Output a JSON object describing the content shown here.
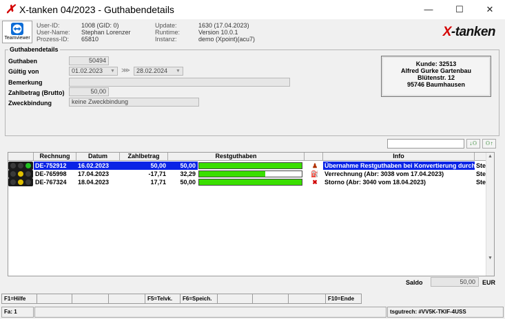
{
  "window": {
    "title": "X-tanken 04/2023 - Guthabendetails",
    "minimize": "—",
    "maximize": "☐",
    "close": "✕"
  },
  "header": {
    "teamviewer_label": "Teamviewer",
    "user_id_label": "User-ID:",
    "user_id": "1008 (GID: 0)",
    "user_name_label": "User-Name:",
    "user_name": "Stephan Lorenzer",
    "prozess_id_label": "Prozess-ID:",
    "prozess_id": "65810",
    "update_label": "Update:",
    "update": "1630 (17.04.2023)",
    "runtime_label": "Runtime:",
    "runtime": "Version 10.0.1",
    "instanz_label": "Instanz:",
    "instanz": "demo (Xpoint)(acu7)",
    "brand_x": "X",
    "brand_rest": "-tanken"
  },
  "details": {
    "group_title": "Guthabendetails",
    "guthaben_label": "Guthaben",
    "guthaben_value": "50494",
    "gueltig_label": "Gültig von",
    "gueltig_von": "01.02.2023",
    "gueltig_bis": "28.02.2024",
    "bemerkung_label": "Bemerkung",
    "bemerkung_value": "",
    "zahlbetrag_label": "Zahlbetrag (Brutto)",
    "zahlbetrag_value": "50,00",
    "zweck_label": "Zweckbindung",
    "zweck_value": "keine Zweckbindung"
  },
  "customer": {
    "line1": "Kunde: 32513",
    "line2": "Alfred Gurke Gartenbau",
    "line3": "Blütenstr. 12",
    "line4": "95746 Baumhausen"
  },
  "table": {
    "headers": [
      "Rechnung",
      "Datum",
      "Zahlbetrag",
      "Restguthaben",
      "Info"
    ],
    "rows": [
      {
        "rechnung": "DE-752912",
        "datum": "16.02.2023",
        "zahlbetrag": "50,00",
        "rest": "50,00",
        "rest_fraction": 1.0,
        "info": "Übernahme Restguthaben bei Konvertierung durch",
        "extra": "Ste",
        "icon": "person-icon"
      },
      {
        "rechnung": "DE-765998",
        "datum": "17.04.2023",
        "zahlbetrag": "-17,71",
        "rest": "32,29",
        "rest_fraction": 0.646,
        "info": "Verrechnung (Abr: 3038 vom 17.04.2023)",
        "extra": "Ste",
        "icon": "pump-icon"
      },
      {
        "rechnung": "DE-767324",
        "datum": "18.04.2023",
        "zahlbetrag": "17,71",
        "rest": "50,00",
        "rest_fraction": 1.0,
        "info": "Storno (Abr: 3040 vom 18.04.2023)",
        "extra": "Ste",
        "icon": "cancel-icon"
      }
    ]
  },
  "saldo": {
    "label": "Saldo",
    "value": "50,00",
    "currency": "EUR"
  },
  "fkeys": {
    "f1": "F1=Hilfe",
    "f5": "F5=Telvk.",
    "f6": "F6=Speich.",
    "f10": "F10=Ende"
  },
  "status": {
    "fa": "Fa: 1",
    "code": "tsgutrech: #VV5K-TKIF-4USS"
  },
  "colors": {
    "selection": "#0a24e6",
    "bar_fill": "#3adf00",
    "brand_red": "#d40000"
  }
}
